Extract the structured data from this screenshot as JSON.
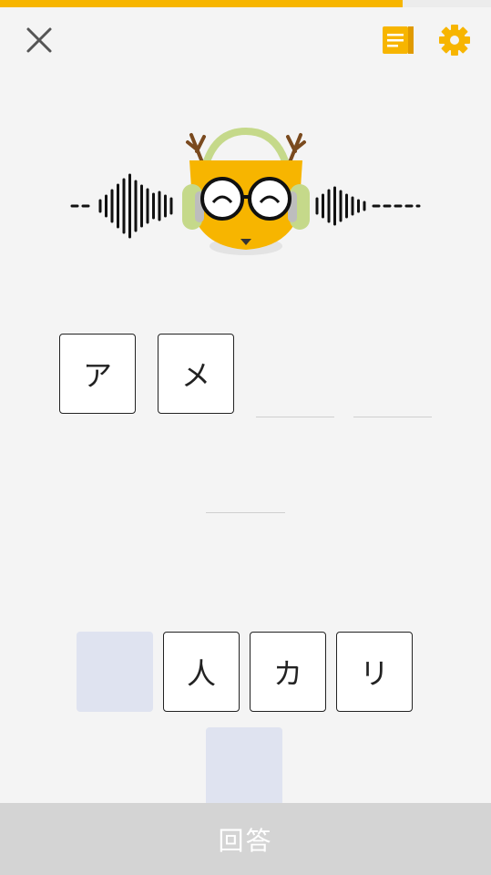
{
  "progress": {
    "value": 0.82,
    "color": "#f7b500"
  },
  "header": {
    "close_icon": "close-icon",
    "notes_icon": "notes-icon",
    "settings_icon": "gear-icon",
    "accent_color": "#f7b500"
  },
  "mascot": {
    "icon": "deer-with-headphones-audio-icon"
  },
  "answer_slots": {
    "row1": [
      "ア",
      "メ",
      "",
      ""
    ],
    "row2": [
      ""
    ]
  },
  "choices": {
    "row1": [
      "",
      "人",
      "カ",
      "リ"
    ],
    "row2": [
      ""
    ]
  },
  "submit": {
    "label": "回答"
  }
}
